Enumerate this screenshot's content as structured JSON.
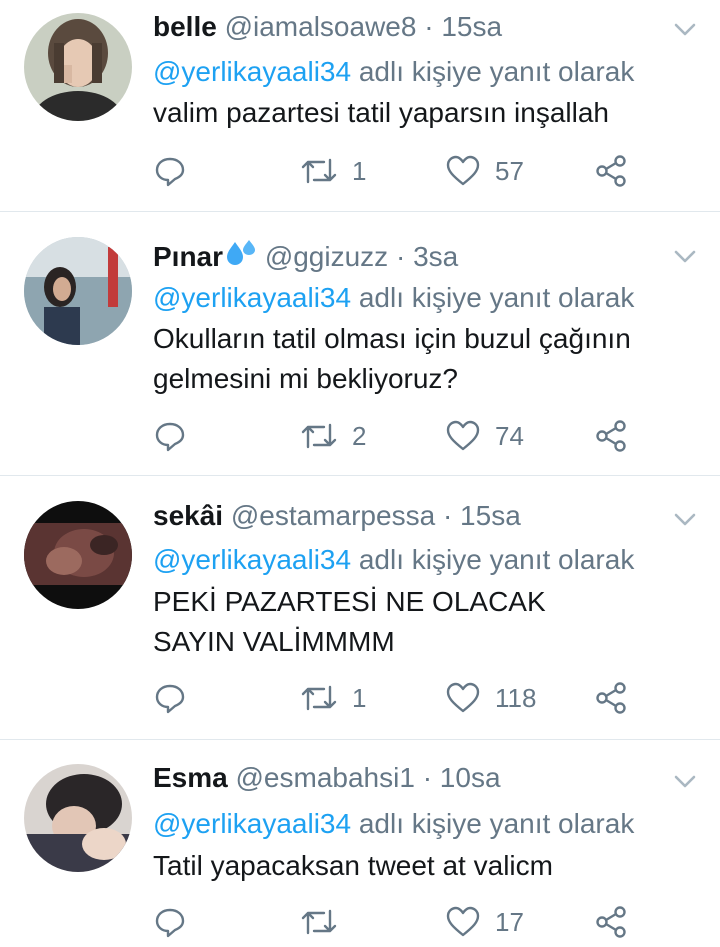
{
  "reply_prefix_text": "adlı kişiye yanıt olarak",
  "dot": "·",
  "colors": {
    "link": "#1da1f2",
    "muted": "#657786",
    "text": "#14171a",
    "divider": "#e1e8ed"
  },
  "tweets": [
    {
      "name": "belle",
      "handle": "@iamalsoawe8",
      "time": "15sa",
      "emoji": "",
      "reply_to": "@yerlikayaali34",
      "text": "valim pazartesi tatil yaparsın inşallah",
      "replies": "",
      "retweets": "1",
      "likes": "57"
    },
    {
      "name": "Pınar",
      "handle": "@ggizuzz",
      "time": "3sa",
      "emoji": "sweat-droplets-emoji",
      "reply_to": "@yerlikayaali34",
      "text": "Okulların tatil olması için buzul çağının gelmesini mi bekliyoruz?",
      "replies": "",
      "retweets": "2",
      "likes": "74"
    },
    {
      "name": "sekâi",
      "handle": "@estamarpessa",
      "time": "15sa",
      "emoji": "",
      "reply_to": "@yerlikayaali34",
      "text": "PEKİ PAZARTESİ NE OLACAK SAYIN VALİMMMM",
      "replies": "",
      "retweets": "1",
      "likes": "118"
    },
    {
      "name": "Esma",
      "handle": "@esmabahsi1",
      "time": "10sa",
      "emoji": "",
      "reply_to": "@yerlikayaali34",
      "text": "Tatil yapacaksan tweet at valicm",
      "replies": "",
      "retweets": "",
      "likes": "17"
    }
  ]
}
